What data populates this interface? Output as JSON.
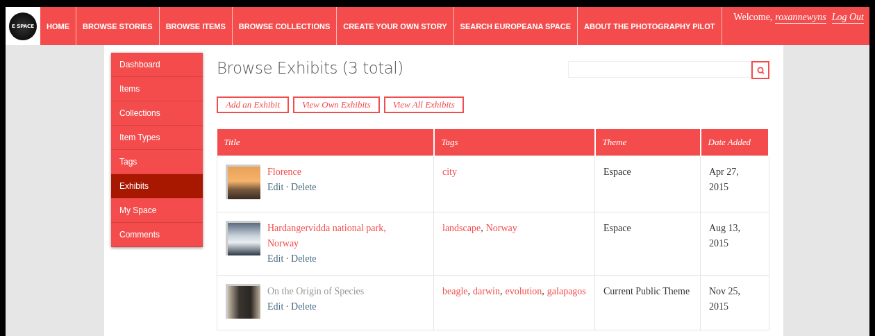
{
  "logo": {
    "text": "E SPACE"
  },
  "nav": [
    {
      "label": "HOME"
    },
    {
      "label": "BROWSE STORIES"
    },
    {
      "label": "BROWSE ITEMS"
    },
    {
      "label": "BROWSE COLLECTIONS"
    },
    {
      "label": "CREATE YOUR OWN STORY"
    },
    {
      "label": "SEARCH EUROPEANA SPACE"
    },
    {
      "label": "ABOUT THE PHOTOGRAPHY PILOT"
    }
  ],
  "user": {
    "welcome": "Welcome,",
    "username": "roxannewyns",
    "logout": "Log Out"
  },
  "sidebar": {
    "items": [
      {
        "label": "Dashboard",
        "selected": false
      },
      {
        "label": "Items",
        "selected": false
      },
      {
        "label": "Collections",
        "selected": false
      },
      {
        "label": "Item Types",
        "selected": false
      },
      {
        "label": "Tags",
        "selected": false
      },
      {
        "label": "Exhibits",
        "selected": true
      },
      {
        "label": "My Space",
        "selected": false
      },
      {
        "label": "Comments",
        "selected": false
      }
    ]
  },
  "page_title": "Browse Exhibits (3 total)",
  "actions": [
    "Add an Exhibit",
    "View Own Exhibits",
    "View All Exhibits"
  ],
  "table": {
    "columns": [
      "Title",
      "Tags",
      "Theme",
      "Date Added"
    ],
    "tag_separator": ",",
    "rows": [
      {
        "title": "Florence",
        "public": true,
        "edit": "Edit",
        "sep": "·",
        "delete": "Delete",
        "tags": [
          "city"
        ],
        "theme": "Espace",
        "date": "Apr 27, 2015"
      },
      {
        "title": "Hardangervidda national park, Norway",
        "public": true,
        "edit": "Edit",
        "sep": "·",
        "delete": "Delete",
        "tags": [
          "landscape",
          "Norway"
        ],
        "theme": "Espace",
        "date": "Aug 13, 2015"
      },
      {
        "title": "On the Origin of Species",
        "public": false,
        "edit": "Edit",
        "sep": "·",
        "delete": "Delete",
        "tags": [
          "beagle",
          "darwin",
          "evolution",
          "galapagos"
        ],
        "theme": "Current Public Theme",
        "date": "Nov 25, 2015"
      }
    ]
  }
}
